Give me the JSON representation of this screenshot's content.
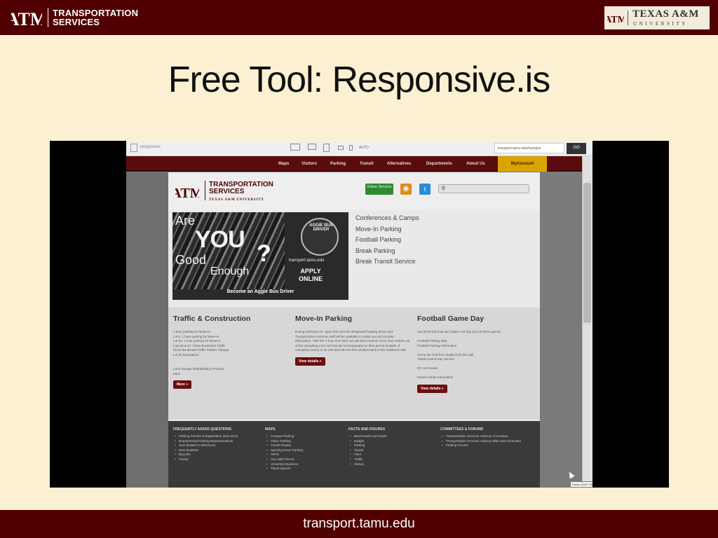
{
  "slide": {
    "brand_logo": "ATM",
    "brand_line1": "TRANSPORTATION",
    "brand_line2": "SERVICES",
    "university_name": "TEXAS A&M",
    "university_sub": "UNIVERSITY",
    "title": "Free Tool: Responsive.is",
    "footer_url": "transport.tamu.edu"
  },
  "browser": {
    "brand": "responsive",
    "size_label": "AUTO",
    "url": "transport.tamu.edu/transpor",
    "go_label": "GO"
  },
  "site": {
    "nav": [
      "Maps",
      "Visitors",
      "Parking",
      "Transit",
      "Alternatives",
      "Departments",
      "About Us"
    ],
    "myaccount": "MyAccount",
    "logo": "ATM",
    "brand_line1": "TRANSPORTATION",
    "brand_line2": "SERVICES",
    "brand_sub": "TEXAS A&M UNIVERSITY",
    "online_label": "Online Services",
    "search_placeholder": "Q",
    "hero": {
      "are": "Are",
      "you": "YOU",
      "good": "Good",
      "enough": "Enough",
      "qmark": "?",
      "wheel_text": "AGGIE BUS DRIVER",
      "url": "transport.tamu.edu",
      "apply": "APPLY",
      "online": "ONLINE",
      "caption": "Become an Aggie Bus Driver"
    },
    "quicklinks": [
      "Conferences & Camps",
      "Move-In Parking",
      "Football Parking",
      "Break Parking",
      "Break Transit Service"
    ],
    "columns": [
      {
        "title": "Traffic & Construction",
        "text": "1 hour parking for Move-In\nLot 6, 1 hour parking for Move-In\nLot 32, 1 hour parking for Move-In\nLots 66 & 67, Close Boulevard Traffic\nClose Boulevard Traffic Pattern Change\nLot 23 Renovation",
        "text2": "Lot & Garage Rehabilitation Projects\nMore",
        "button": "More »"
      },
      {
        "title": "Move-In Parking",
        "text": "During Fall Move-In, signs will mark the designated loading areas and Transportation Services staff will be available to assist you and provide information. After the 1-hour time limit, we ask that students move their vehicle out of the unloading zone and into the lot designated on their permit (outside of unloading zones) or lot 100 and ride the free shuttles back to the residence hall.",
        "text2": "",
        "button": "View details »"
      },
      {
        "title": "Football Game Day",
        "text": "Joe Routt will close at 1:30pm one day prior to home games.\n\nFootball Parking Map\nFootball Parking Information\n\nGet to the Grid free shuttle from the mall\nTransit Game Day Service\n\nRV Lot Passes\n\nParent Holder Information",
        "text2": "",
        "button": "View details »"
      }
    ],
    "footer_cols": [
      {
        "title": "FREQUENTLY ASKED QUESTIONS",
        "items": [
          "Parking Permits & Registration 2012-2013",
          "Departmental Parking Representatives",
          "New Student Conferences",
          "New Students",
          "Bicycles",
          "Transit"
        ]
      },
      {
        "title": "MAPS",
        "items": [
          "Campus Parking",
          "Visitor Parking",
          "Transit Routes",
          "Sporting Event Parking",
          "OPAS",
          "Any Valid Permit",
          "University Business",
          "Timed Spaces"
        ]
      },
      {
        "title": "FACTS AND FIGURES",
        "items": [
          "Benchmarks and Goals",
          "Budget",
          "Parking",
          "Transit",
          "Fleet",
          "Traffic",
          "History"
        ]
      },
      {
        "title": "COMMITTEES & FORUMS",
        "items": [
          "Transportation Services Advisory Committee",
          "Transportation Services Advisory Bike Sub-committee",
          "Parking Forums"
        ]
      }
    ],
    "tooltip": "Pause (SVK+T8)"
  },
  "colors": {
    "maroon": "#500000",
    "slide_bg": "#fcf0d3",
    "myaccount_gold": "#d9a300"
  }
}
